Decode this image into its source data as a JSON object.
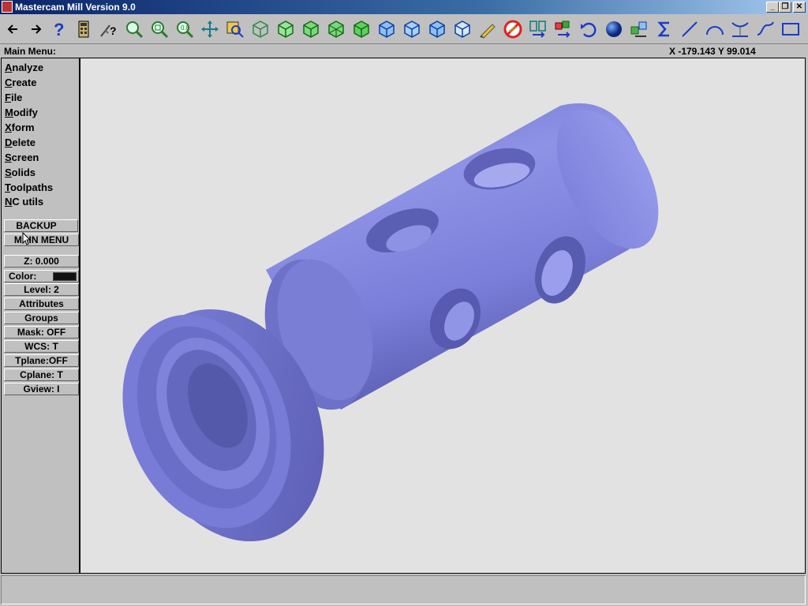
{
  "window": {
    "title": "Mastercam Mill Version 9.0"
  },
  "toolbar": {
    "icons": [
      "arrow-left-icon",
      "arrow-right-icon",
      "help-icon",
      "calculator-icon",
      "analyze-icon",
      "zoom-icon",
      "unzoom-icon",
      "zoom-fit-icon",
      "pan-icon",
      "select-zoom-icon",
      "rotate-icon",
      "iso-view-green-1-icon",
      "iso-view-green-2-icon",
      "iso-view-green-3-icon",
      "iso-view-green-4-icon",
      "cube-view-1-icon",
      "cube-view-2-icon",
      "cube-view-3-icon",
      "cube-view-4-icon",
      "pencil-icon",
      "no-delete-icon",
      "move-icon",
      "copy-icon",
      "undo-icon",
      "shade-sphere-icon",
      "layers-icon",
      "sigma-icon",
      "line-icon",
      "arc-icon",
      "fillet-icon",
      "spline-icon",
      "rectangle-icon"
    ]
  },
  "menubar": {
    "main_menu": "Main Menu:",
    "coords": "X -179.143  Y 99.014"
  },
  "menu": {
    "items": [
      {
        "hot": "A",
        "rest": "nalyze"
      },
      {
        "hot": "C",
        "rest": "reate"
      },
      {
        "hot": "F",
        "rest": "ile"
      },
      {
        "hot": "M",
        "rest": "odify"
      },
      {
        "hot": "X",
        "rest": "form"
      },
      {
        "hot": "D",
        "rest": "elete"
      },
      {
        "hot": "S",
        "rest": "creen"
      },
      {
        "hot": "S",
        "rest": "olids"
      },
      {
        "hot": "T",
        "rest": "oolpaths"
      },
      {
        "hot": "N",
        "rest": "C utils"
      }
    ],
    "backup": "BACKUP",
    "main_menu_btn": "MAIN MENU"
  },
  "settings": {
    "z": "Z:   0.000",
    "color": "Color:",
    "color_value": "#111111",
    "level": "Level:  2",
    "attributes": "Attributes",
    "groups": "Groups",
    "mask": "Mask:  OFF",
    "wcs": "WCS:   T",
    "tplane": "Tplane:OFF",
    "cplane": "Cplane:  T",
    "gview": "Gview:   I"
  },
  "colors": {
    "model_base": "#7b7fd8",
    "model_dark": "#5d60b0",
    "model_light": "#9a9ee8",
    "viewport_bg": "#e2e2e2"
  }
}
